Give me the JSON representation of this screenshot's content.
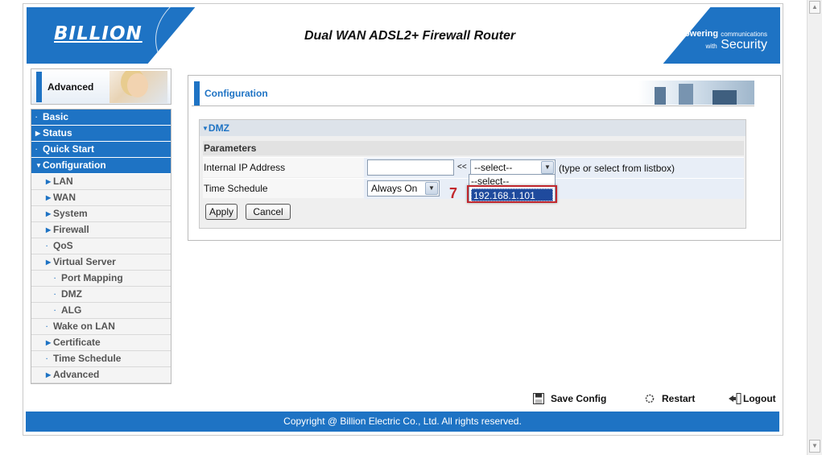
{
  "header": {
    "logo": "BILLION",
    "title": "Dual WAN ADSL2+ Firewall Router",
    "tagline_bold": "Powering",
    "tagline_small": "communications",
    "tagline_with": "with",
    "tagline_big": "Security"
  },
  "sidebar": {
    "mode_label": "Advanced",
    "items": [
      {
        "label": "Basic",
        "level": "top",
        "marker": "·"
      },
      {
        "label": "Status",
        "level": "top",
        "marker": "▶"
      },
      {
        "label": "Quick Start",
        "level": "top",
        "marker": "·"
      },
      {
        "label": "Configuration",
        "level": "top",
        "marker": "▼"
      },
      {
        "label": "LAN",
        "level": "sub",
        "marker": "▶"
      },
      {
        "label": "WAN",
        "level": "sub",
        "marker": "▶"
      },
      {
        "label": "System",
        "level": "sub",
        "marker": "▶"
      },
      {
        "label": "Firewall",
        "level": "sub",
        "marker": "▶"
      },
      {
        "label": "QoS",
        "level": "sub",
        "marker": "·"
      },
      {
        "label": "Virtual Server",
        "level": "sub",
        "marker": "▶"
      },
      {
        "label": "Port Mapping",
        "level": "sub2",
        "marker": "·"
      },
      {
        "label": "DMZ",
        "level": "sub2",
        "marker": "·"
      },
      {
        "label": "ALG",
        "level": "sub2",
        "marker": "·"
      },
      {
        "label": "Wake on LAN",
        "level": "sub",
        "marker": "·"
      },
      {
        "label": "Certificate",
        "level": "sub",
        "marker": "▶"
      },
      {
        "label": "Time Schedule",
        "level": "sub",
        "marker": "·"
      },
      {
        "label": "Advanced",
        "level": "sub",
        "marker": "▶"
      }
    ]
  },
  "content": {
    "section_title": "Configuration",
    "panel_title": "DMZ",
    "params_label": "Parameters",
    "ip_label": "Internal IP Address",
    "ip_value": "",
    "ll_symbol": "<<",
    "ip_select_value": "--select--",
    "ip_hint": "(type or select from listbox)",
    "schedule_label": "Time Schedule",
    "schedule_value": "Always On",
    "apply_label": "Apply",
    "cancel_label": "Cancel",
    "dropdown_options": [
      "--select--",
      "192.168.1.101"
    ],
    "step_number": "7"
  },
  "actions": {
    "save_config": "Save Config",
    "restart": "Restart",
    "logout": "Logout"
  },
  "footer": {
    "copyright": "Copyright @ Billion Electric Co., Ltd. All rights reserved."
  },
  "colors": {
    "brand_blue": "#1e73c4",
    "highlight_red": "#c2272d",
    "selected_option": "#1f4a9d"
  }
}
